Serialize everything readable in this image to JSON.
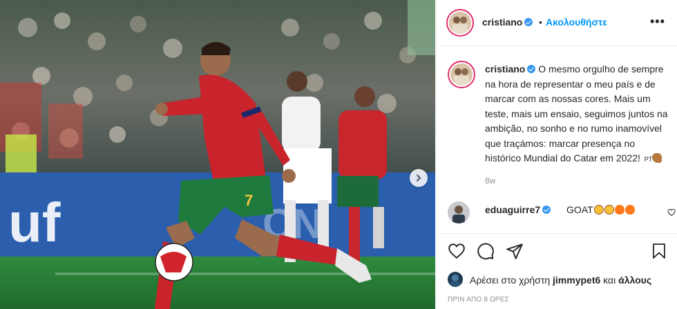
{
  "post": {
    "username": "cristiano",
    "follow_label": "Ακολουθήστε",
    "more_label": "•••",
    "separator": "•"
  },
  "caption": {
    "username": "cristiano",
    "text": "O mesmo orgulho de sempre na hora de representar o meu país e de marcar com as nossas cores. Mais um teste, mais um ensaio, seguimos juntos na ambição, no sonho e no rumo inamovível que traçámos: marcar presença no histórico Mundial do Catar em 2022!",
    "tag": "PT",
    "time_ago": "8w"
  },
  "comment": {
    "username": "eduaguirre7",
    "text": "GOAT"
  },
  "likes": {
    "prefix": "Αρέσει στο χρήστη",
    "user": "jimmypet6",
    "conj": "και",
    "others": "άλλους"
  },
  "posted_label": "ΠΡΙΝ ΑΠΟ 8 ΩΡΕΣ",
  "icons": {
    "like": "heart-icon",
    "comment": "comment-icon",
    "share": "share-icon",
    "save": "bookmark-icon",
    "next": "chevron-right-icon",
    "verified": "verified-badge-icon"
  },
  "colors": {
    "follow": "#0095f6",
    "verified": "#3897f0",
    "meta": "#8e8e8e"
  }
}
